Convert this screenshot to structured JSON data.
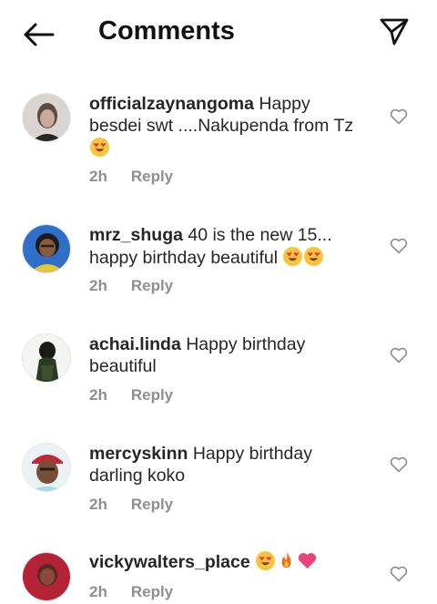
{
  "header": {
    "title": "Comments",
    "back_icon": "arrow-left-icon",
    "send_icon": "paper-plane-icon"
  },
  "comments": [
    {
      "username": "officialzaynangoma",
      "text_before": " Happy besdei swt ....Nakupenda from Tz",
      "emojis": [
        "heart-eyes-emoji"
      ],
      "time": "2h",
      "reply": "Reply",
      "avatar_color": "#c9c4c0"
    },
    {
      "username": "mrz_shuga",
      "text_before": " 40 is the new 15... happy birthday beautiful ",
      "emojis": [
        "heart-eyes-emoji",
        "heart-eyes-emoji"
      ],
      "time": "2h",
      "reply": "Reply",
      "avatar_color": "#3a74c9"
    },
    {
      "username": "achai.linda",
      "text_before": " Happy birthday beautiful",
      "emojis": [],
      "time": "2h",
      "reply": "Reply",
      "avatar_color": "#2c2a24"
    },
    {
      "username": "mercyskinn",
      "text_before": " Happy birthday darling koko",
      "emojis": [],
      "time": "2h",
      "reply": "Reply",
      "avatar_color": "#7a5a48"
    },
    {
      "username": "vickywalters_place",
      "text_before": " ",
      "emojis": [
        "heart-eyes-emoji",
        "fire-emoji",
        "pink-heart-emoji"
      ],
      "time": "2h",
      "reply": "Reply",
      "avatar_color": "#b0243a"
    }
  ]
}
